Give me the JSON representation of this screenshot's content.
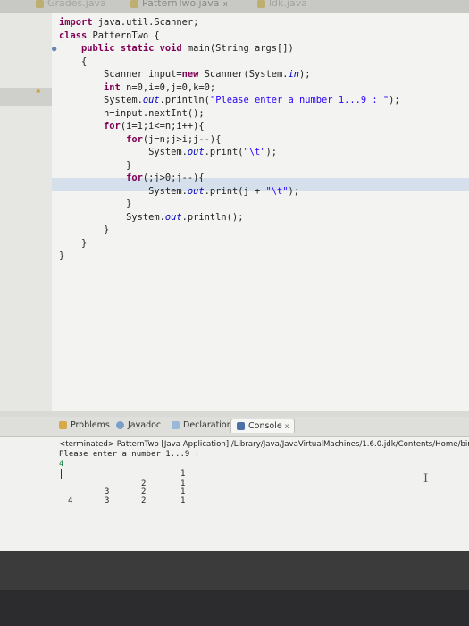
{
  "tabs": [
    {
      "label": "Grades.java"
    },
    {
      "label": "PatternTwo.java",
      "close": "x"
    },
    {
      "label": "ldk.java"
    }
  ],
  "code_lines": [
    "import java.util.Scanner;",
    "class PatternTwo {",
    "    public static void main(String args[])",
    "    {",
    "        Scanner input=new Scanner(System.in);",
    "        int n=0,i=0,j=0,k=0;",
    "        System.out.println(\"Please enter a number 1...9 : \");",
    "        n=input.nextInt();",
    "        for(i=1;i<=n;i++){",
    "            for(j=n;j>i;j--){",
    "                System.out.print(\"\\t\");",
    "            }",
    "            for(;j>0;j--){",
    "                System.out.print(j + \"\\t\");",
    "            }",
    "            System.out.println();",
    "        }",
    "    }",
    "}"
  ],
  "panel": {
    "tabs": [
      "Problems",
      "Javadoc",
      "Declaration",
      "Console"
    ],
    "active_tab": "Console",
    "close": "x",
    "terminated": "<terminated> PatternTwo [Java Application] /Library/Java/JavaVirtualMachines/1.6.0.jdk/Contents/Home/bin/ja",
    "prompt": "Please enter a number 1...9 :",
    "input_value": "4",
    "output_rows": [
      [
        "",
        "",
        "",
        "1"
      ],
      [
        "",
        "",
        "2",
        "1"
      ],
      [
        "",
        "3",
        "2",
        "1"
      ],
      [
        "4",
        "3",
        "2",
        "1"
      ]
    ]
  }
}
